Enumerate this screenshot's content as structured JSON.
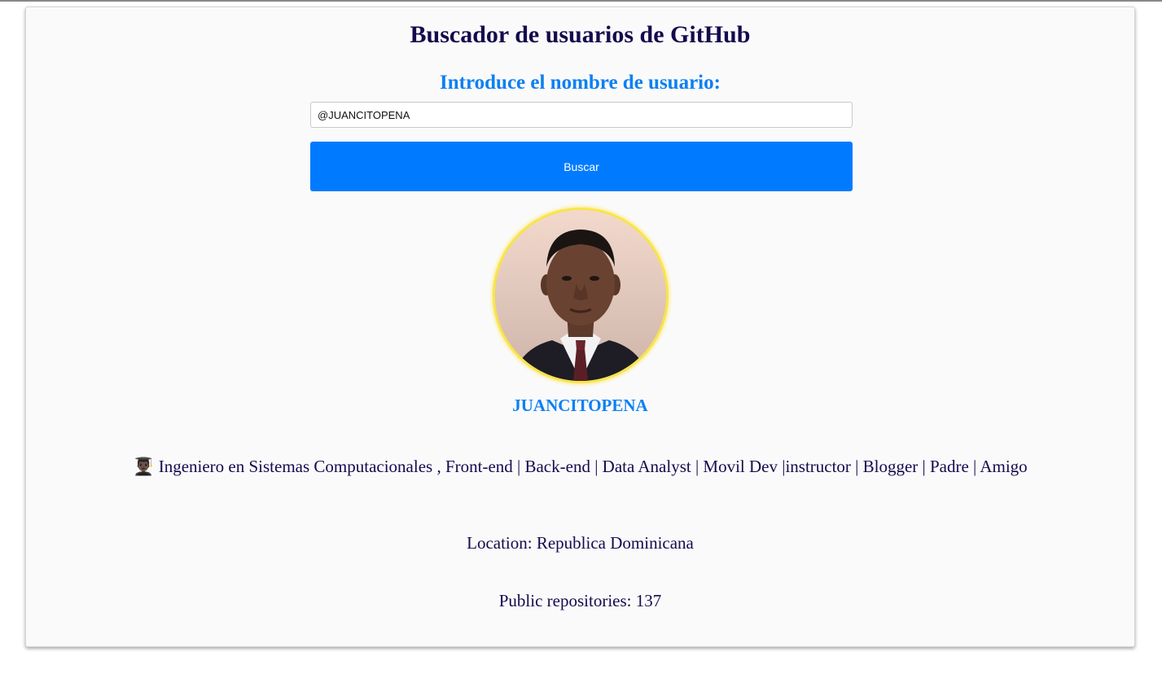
{
  "header": {
    "title": "Buscador de usuarios de GitHub"
  },
  "search": {
    "label": "Introduce el nombre de usuario:",
    "value": "@JUANCITOPENA",
    "placeholder": "",
    "button_label": "Buscar"
  },
  "profile": {
    "avatar_alt": "avatar",
    "username": "JUANCITOPENA",
    "bio_emoji": "👨🏿‍🎓",
    "bio": "Ingeniero en Sistemas Computacionales , Front-end | Back-end | Data Analyst | Movil Dev |instructor | Blogger | Padre | Amigo",
    "location": "Location: Republica Dominicana",
    "public_repos": "Public repositories: 137"
  },
  "colors": {
    "accent": "#007bff",
    "heading": "#140b4d",
    "label": "#0d80f2",
    "avatar_border": "#f7e44c"
  }
}
